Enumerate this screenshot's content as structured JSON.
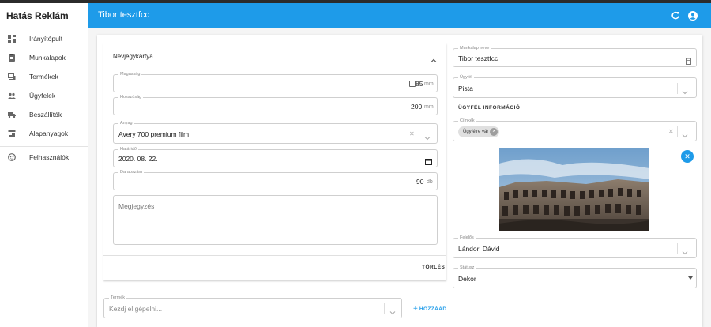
{
  "sidebar": {
    "brand": "Hatás Reklám",
    "items": [
      {
        "label": "Irányítópult",
        "icon": "dashboard-icon"
      },
      {
        "label": "Munkalapok",
        "icon": "clipboard-icon"
      },
      {
        "label": "Termékek",
        "icon": "devices-icon"
      },
      {
        "label": "Ügyfelek",
        "icon": "people-icon"
      },
      {
        "label": "Beszállítók",
        "icon": "truck-icon"
      },
      {
        "label": "Alapanyagok",
        "icon": "store-icon"
      }
    ],
    "admin_item": {
      "label": "Felhasználók",
      "icon": "face-icon"
    }
  },
  "appbar": {
    "title": "Tibor tesztfcc",
    "accent": "#1e9be9"
  },
  "product_panel": {
    "header": "Névjegykártya",
    "magassag": {
      "label": "Magasság",
      "value": "85",
      "unit": "mm"
    },
    "hosszusag": {
      "label": "Hosszúság",
      "value": "200",
      "unit": "mm"
    },
    "anyag": {
      "label": "Anyag",
      "value": "Avery 700 premium film"
    },
    "hatarido": {
      "label": "Határidő",
      "value": "2020. 08. 22."
    },
    "darabszam": {
      "label": "Darabszám",
      "value": "90",
      "unit": "db"
    },
    "megjegyzes": {
      "placeholder": "Megjegyzés"
    },
    "delete_label": "TÖRLÉS"
  },
  "add_product": {
    "label": "Termék",
    "placeholder": "Kezdj el gépelni...",
    "add_label": "HOZZÁAD"
  },
  "right": {
    "munkalap": {
      "label": "Munkalap neve",
      "value": "Tibor tesztfcc"
    },
    "ugyfel": {
      "label": "Ügyfél",
      "value": "Pista"
    },
    "info_label": "ÜGYFÉL INFORMÁCIÓ",
    "cimkek": {
      "label": "Címkék",
      "chip": "Ügyfélre vár"
    },
    "felelos": {
      "label": "Felelős",
      "value": "Lándori Dávid"
    },
    "statusz": {
      "label": "Státusz",
      "value": "Dekor"
    }
  }
}
